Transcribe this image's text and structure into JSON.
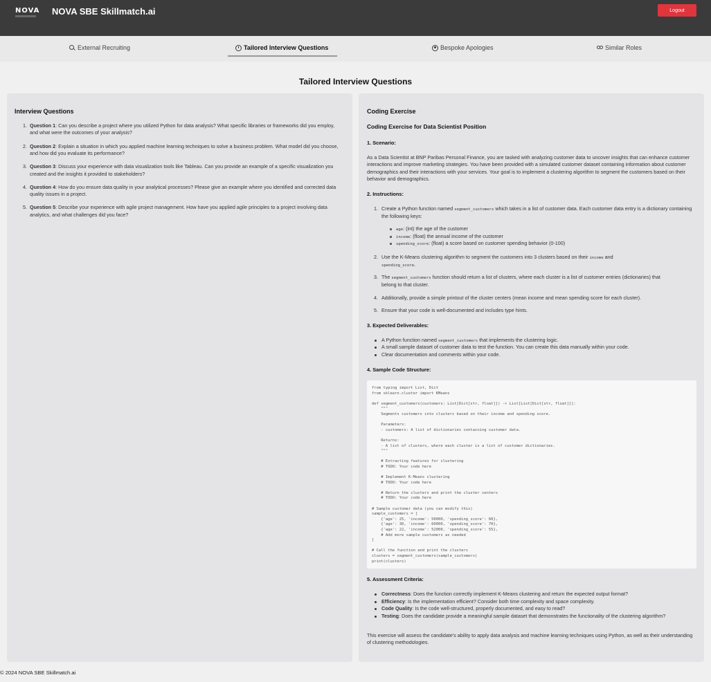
{
  "header": {
    "logo_text": "NOVA",
    "title": "NOVA SBE Skillmatch.ai",
    "logout_label": "Logout"
  },
  "tabs": [
    {
      "label": "External Recruiting",
      "icon": "search-icon"
    },
    {
      "label": "Tailored Interview Questions",
      "icon": "clock-icon",
      "active": true
    },
    {
      "label": "Bespoke Apologies",
      "icon": "user-icon"
    },
    {
      "label": "Similar Roles",
      "icon": "people-icon"
    }
  ],
  "page_title": "Tailored Interview Questions",
  "left": {
    "heading": "Interview Questions",
    "questions": [
      {
        "num": "1.",
        "label": "Question 1",
        "text": ": Can you describe a project where you utilized Python for data analysis? What specific libraries or frameworks did you employ, and what were the outcomes of your analysis?"
      },
      {
        "num": "2.",
        "label": "Question 2",
        "text": ": Explain a situation in which you applied machine learning techniques to solve a business problem. What model did you choose, and how did you evaluate its performance?"
      },
      {
        "num": "3.",
        "label": "Question 3",
        "text": ": Discuss your experience with data visualization tools like Tableau. Can you provide an example of a specific visualization you created and the insights it provided to stakeholders?"
      },
      {
        "num": "4.",
        "label": "Question 4",
        "text": ": How do you ensure data quality in your analytical processes? Please give an example where you identified and corrected data quality issues in a project."
      },
      {
        "num": "5.",
        "label": "Question 5",
        "text": ": Describe your experience with agile project management. How have you applied agile principles to a project involving data analytics, and what challenges did you face?"
      }
    ]
  },
  "right": {
    "heading": "Coding Exercise",
    "subheading": "Coding Exercise for Data Scientist Position",
    "scenario_title": "1. Scenario:",
    "scenario_text": "As a Data Scientist at BNP Paribas Personal Finance, you are tasked with analyzing customer data to uncover insights that can enhance customer interactions and improve marketing strategies. You have been provided with a simulated customer dataset containing information about customer demographics and their interactions with your services. Your goal is to implement a clustering algorithm to segment the customers based on their behavior and demographics.",
    "instructions_title": "2. Instructions:",
    "inst1_a": "Create a Python function named",
    "inst1_code": "segment_customers",
    "inst1_b": "which takes in a list of customer data. Each customer data entry is a dictionary containing the following keys:",
    "keys": [
      {
        "code": "age",
        "text": ": (int) the age of the customer"
      },
      {
        "code": "income",
        "text": ": (float) the annual income of the customer"
      },
      {
        "code": "spending_score",
        "text": ": (float) a score based on customer spending behavior (0-100)"
      }
    ],
    "inst2_a": "Use the K-Means clustering algorithm to segment the customers into 3 clusters based on their",
    "inst2_code1": "income",
    "inst2_and": "and",
    "inst2_code2": "spending_score",
    "inst2_end": ".",
    "inst3_a": "The",
    "inst3_code": "segment_customers",
    "inst3_b": "function should return a list of clusters, where each cluster is a list of customer entries (dictionaries) that belong to that cluster.",
    "inst4": "Additionally, provide a simple printout of the cluster centers (mean income and mean spending score for each cluster).",
    "inst5": "Ensure that your code is well-documented and includes type hints.",
    "deliverables_title": "3. Expected Deliverables:",
    "deliv1_a": "A Python function named",
    "deliv1_code": "segment_customers",
    "deliv1_b": "that implements the clustering logic.",
    "deliv2": "A small sample dataset of customer data to test the function. You can create this data manually within your code.",
    "deliv3": "Clear documentation and comments within your code.",
    "sample_title": "4. Sample Code Structure:",
    "code": "from typing import List, Dict\nfrom sklearn.cluster import KMeans\n\ndef segment_customers(customers: List[Dict[str, float]]) -> List[List[Dict[str, float]]]:\n    \"\"\"\n    Segments customers into clusters based on their income and spending score.\n\n    Parameters:\n    - customers: A list of dictionaries containing customer data.\n\n    Returns:\n    - A list of clusters, where each cluster is a list of customer dictionaries.\n    \"\"\"\n\n    # Extracting features for clustering\n    # TODO: Your code here\n\n    # Implement K-Means clustering\n    # TODO: Your code here\n\n    # Return the clusters and print the cluster centers\n    # TODO: Your code here\n\n# Sample customer data (you can modify this)\nsample_customers = [\n    {'age': 25, 'income': 50000, 'spending_score': 60},\n    {'age': 30, 'income': 60000, 'spending_score': 70},\n    {'age': 22, 'income': 52000, 'spending_score': 55},\n    # Add more sample customers as needed\n]\n\n# Call the function and print the clusters\nclusters = segment_customers(sample_customers)\nprint(clusters)",
    "criteria_title": "5. Assessment Criteria:",
    "criteria": [
      {
        "label": "Correctness",
        "text": ": Does the function correctly implement K-Means clustering and return the expected output format?"
      },
      {
        "label": "Efficiency",
        "text": ": Is the implementation efficient? Consider both time complexity and space complexity."
      },
      {
        "label": "Code Quality",
        "text": ": Is the code well-structured, properly documented, and easy to read?"
      },
      {
        "label": "Testing",
        "text": ": Does the candidate provide a meaningful sample dataset that demonstrates the functionality of the clustering algorithm?"
      }
    ],
    "closing": "This exercise will assess the candidate's ability to apply data analysis and machine learning techniques using Python, as well as their understanding of clustering methodologies."
  },
  "footer": "© 2024 NOVA SBE Skillmatch.ai",
  "colors": {
    "header_bg": "#3b3b3c",
    "logout": "#e0353d",
    "panel": "#e4e4e6"
  }
}
